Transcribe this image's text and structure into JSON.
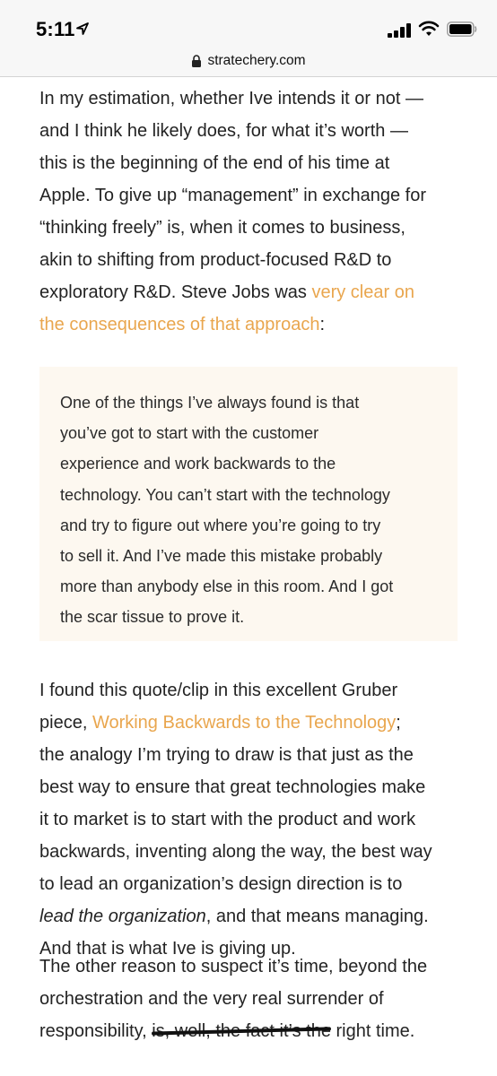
{
  "status_bar": {
    "time": "5:11"
  },
  "browser": {
    "url": "stratechery.com"
  },
  "article": {
    "p1": {
      "l1": "In my estimation, whether Ive intends it or not —",
      "l2": "and I think he likely does, for what it’s worth —",
      "l3": "this is the beginning of the end of his time at",
      "l4": "Apple. To give up “management” in exchange for",
      "l5": "“thinking freely” is, when it comes to business,",
      "l6": "akin to shifting from product-focused R&D to",
      "l7a": "exploratory R&D. Steve Jobs was ",
      "l7_link": "very clear on",
      "l8_link": "the consequences of that approach",
      "l8b": ":"
    },
    "quote": {
      "l1": "One of the things I’ve always found is that",
      "l2": "you’ve got to start with the customer",
      "l3": "experience and work backwards to the",
      "l4": "technology. You can’t start with the technology",
      "l5": "and try to figure out where you’re going to try",
      "l6": "to sell it. And I’ve made this mistake probably",
      "l7": "more than anybody else in this room. And I got",
      "l8": "the scar tissue to prove it."
    },
    "p2": {
      "l1": "I found this quote/clip in this excellent Gruber",
      "l2a": "piece, ",
      "l2_link": "Working Backwards to the Technology",
      "l2b": ";",
      "l3": "the analogy I’m trying to draw is that just as the",
      "l4": "best way to ensure that great technologies make",
      "l5": "it to market is to start with the product and work",
      "l6": "backwards, inventing along the way, the best way",
      "l7": "to lead an organization’s design direction is to",
      "l8_em": "lead the organization",
      "l8b": ", and that means managing.",
      "l9": "And that is what Ive is giving up."
    },
    "p3": {
      "l1": "The other reason to suspect it’s time, beyond the",
      "l2": "orchestration and the very real surrender of",
      "l3a": "responsibility, ",
      "l3_struck": "is, well, the fact it’s the",
      "l3b": " right time."
    }
  }
}
